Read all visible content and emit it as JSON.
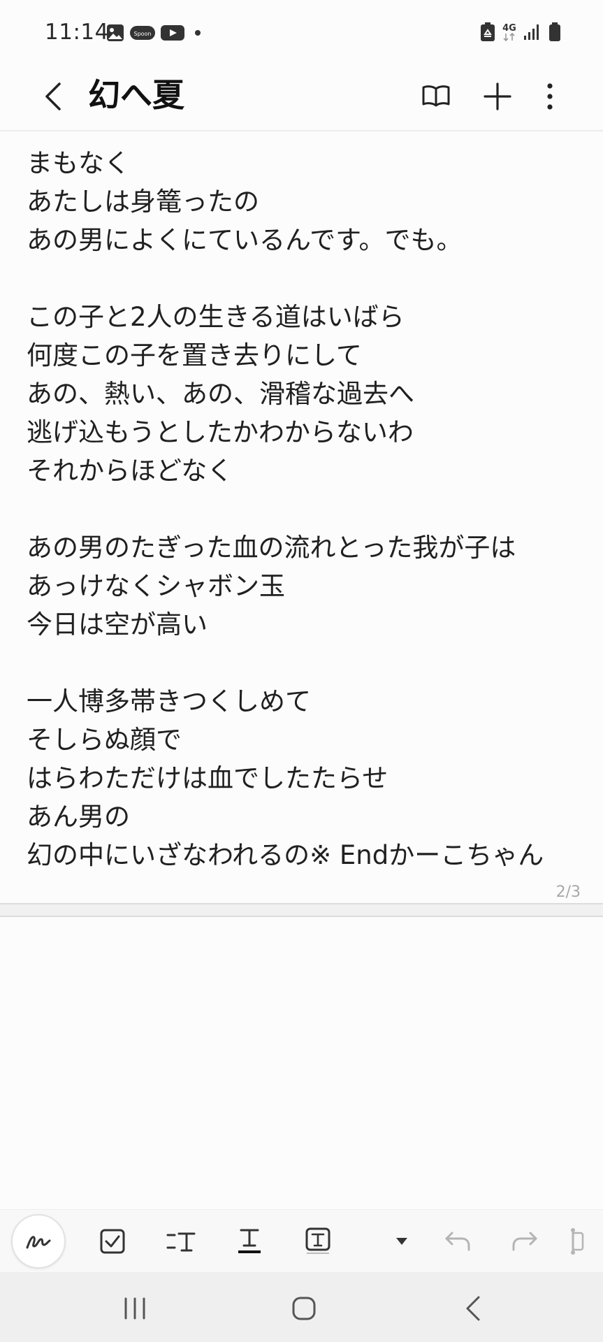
{
  "status_bar": {
    "time": "11:14",
    "left_icons": [
      "image-icon",
      "spoon-app-icon",
      "youtube-icon",
      "notification-dot-icon"
    ],
    "spoon_label": "Spoon",
    "network_label": "4G",
    "right_icons": [
      "recycle-battery-saver-icon",
      "4g-data-icon",
      "signal-icon",
      "battery-icon"
    ]
  },
  "app_bar": {
    "title": "幻へ夏",
    "actions": [
      "book-view-icon",
      "add-icon",
      "more-vert-icon"
    ]
  },
  "note": {
    "lines": [
      "まもなく",
      "あたしは身篭ったの",
      "あの男によくにているんです。でも。",
      "",
      "この子と2人の生きる道はいばら",
      "何度この子を置き去りにして",
      "あの、熱い、あの、滑稽な過去へ",
      "逃げ込もうとしたかわからないわ",
      "それからほどなく",
      "",
      "あの男のたぎった血の流れとった我が子は",
      "あっけなくシャボン玉",
      "今日は空が高い",
      "",
      "一人博多帯きつくしめて",
      "そしらぬ顔で",
      "はらわただけは血でしたたらせ",
      "あん男の",
      "幻の中にいざなわれるの※  Endかーこちゃん"
    ],
    "page_indicator": "2/3"
  },
  "toolbar": {
    "items": [
      "handwriting-pen-icon",
      "checkbox-icon",
      "text-style-icon",
      "text-underline-icon",
      "text-box-icon",
      "dropdown-icon",
      "undo-icon",
      "redo-icon",
      "more-tools-icon"
    ]
  },
  "nav_bar": {
    "items": [
      "recent-apps-icon",
      "home-icon",
      "back-nav-icon"
    ]
  },
  "colors": {
    "background": "#fcfcfc",
    "text": "#202020",
    "toolbar_bg": "#f8f8f8",
    "nav_bg": "#efefef",
    "muted": "#a8a8a8"
  }
}
